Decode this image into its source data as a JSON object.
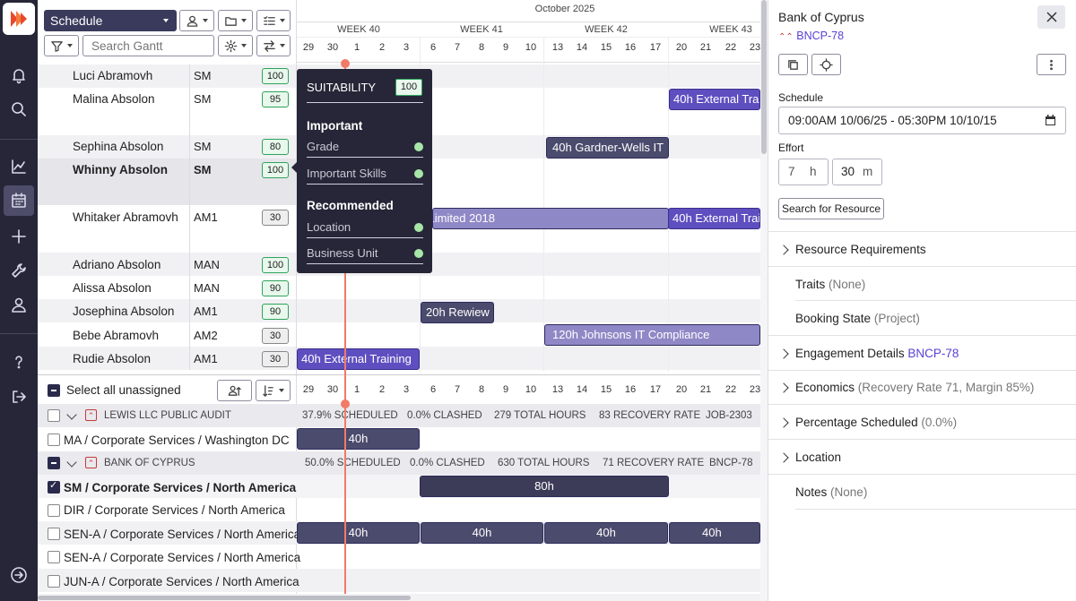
{
  "toolbar": {
    "view_select": "Schedule",
    "search_placeholder": "Search Gantt"
  },
  "timeline": {
    "month": "October 2025",
    "weeks": [
      "WEEK 40",
      "WEEK 41",
      "WEEK 42",
      "WEEK 43"
    ],
    "days": [
      "29",
      "30",
      "1",
      "2",
      "3",
      "6",
      "7",
      "8",
      "9",
      "10",
      "13",
      "14",
      "15",
      "16",
      "17",
      "20",
      "21",
      "22",
      "23"
    ]
  },
  "resources": [
    {
      "name": "Luci Abramovh",
      "role": "SM",
      "score": "100"
    },
    {
      "name": "Malina Absolon",
      "role": "SM",
      "score": "95"
    },
    {
      "name": "Sephina Absolon",
      "role": "SM",
      "score": "80"
    },
    {
      "name": "Whinny Absolon",
      "role": "SM",
      "score": "100"
    },
    {
      "name": "Whitaker Abramovh",
      "role": "AM1",
      "score": "30"
    },
    {
      "name": "Adriano Absolon",
      "role": "MAN",
      "score": "100"
    },
    {
      "name": "Alissa Absolon",
      "role": "MAN",
      "score": "90"
    },
    {
      "name": "Josephina Absolon",
      "role": "AM1",
      "score": "90"
    },
    {
      "name": "Bebe Abramovh",
      "role": "AM2",
      "score": "30"
    },
    {
      "name": "Rudie Absolon",
      "role": "AM1",
      "score": "30"
    }
  ],
  "bars": {
    "malina": "40h External Training",
    "sephina": "40h Gardner-Wells IT",
    "whitaker_a": "40h Kell Regs Limited 2018",
    "whitaker_b": "40h External Training",
    "josephina": "20h Rewiew",
    "bebe": "120h Johnsons IT Compliance",
    "rudie": "40h External Training"
  },
  "tooltip": {
    "title": "SUITABILITY",
    "score": "100",
    "important_heading": "Important",
    "important_items": [
      "Grade",
      "Important Skills"
    ],
    "recommended_heading": "Recommended",
    "recommended_items": [
      "Location",
      "Business Unit"
    ]
  },
  "unassigned": {
    "select_all": "Select all unassigned",
    "groups": [
      {
        "name": "LEWIS LLC PUBLIC AUDIT",
        "scheduled": "37.9% SCHEDULED",
        "clashed": "0.0% CLASHED",
        "hours": "279 TOTAL HOURS",
        "recovery": "83 RECOVERY RATE",
        "code": "JOB-2303"
      },
      {
        "name": "BANK OF CYPRUS",
        "scheduled": "50.0% SCHEDULED",
        "clashed": "0.0% CLASHED",
        "hours": "630 TOTAL HOURS",
        "recovery": "71 RECOVERY RATE",
        "code": "BNCP-78"
      }
    ],
    "requirements": [
      {
        "label": "MA / Corporate Services / Washington DC",
        "bar": "40h"
      },
      {
        "label": "SM / Corporate Services / North America",
        "bar": "80h"
      },
      {
        "label": "DIR / Corporate Services / North America",
        "bar": ""
      },
      {
        "label": "SEN-A / Corporate Services / North America",
        "bar": "40h"
      },
      {
        "label": "SEN-A / Corporate Services / North America",
        "bar": ""
      },
      {
        "label": "JUN-A / Corporate Services / North America",
        "bar": ""
      }
    ]
  },
  "panel": {
    "title": "Bank of Cyprus",
    "code": "BNCP-78",
    "schedule_label": "Schedule",
    "schedule_value": "09:00AM 10/06/25 - 05:30PM 10/10/15",
    "effort_label": "Effort",
    "effort_hours": "7",
    "effort_hours_unit": "h",
    "effort_minutes": "30",
    "effort_minutes_unit": "m",
    "search_button": "Search for Resource",
    "sections": [
      {
        "label": "Resource Requirements",
        "sub": "",
        "expandable": true
      },
      {
        "label": "Traits",
        "sub": "(None)",
        "expandable": false
      },
      {
        "label": "Booking State",
        "sub": "(Project)",
        "expandable": false
      },
      {
        "label": "Engagement Details",
        "sub": "BNCP-78",
        "expandable": true
      },
      {
        "label": "Economics",
        "sub": "(Recovery Rate 71, Margin 85%)",
        "expandable": true
      },
      {
        "label": "Percentage Scheduled",
        "sub": "(0.0%)",
        "expandable": true
      },
      {
        "label": "Location",
        "sub": "",
        "expandable": true
      },
      {
        "label": "Notes",
        "sub": "(None)",
        "expandable": false
      }
    ]
  },
  "colors": {
    "accent": "#e64a19",
    "bar": "#8f88c6",
    "bar_dark": "#4b4b6d",
    "rail": "#262638",
    "today_line": "#f07b66"
  }
}
